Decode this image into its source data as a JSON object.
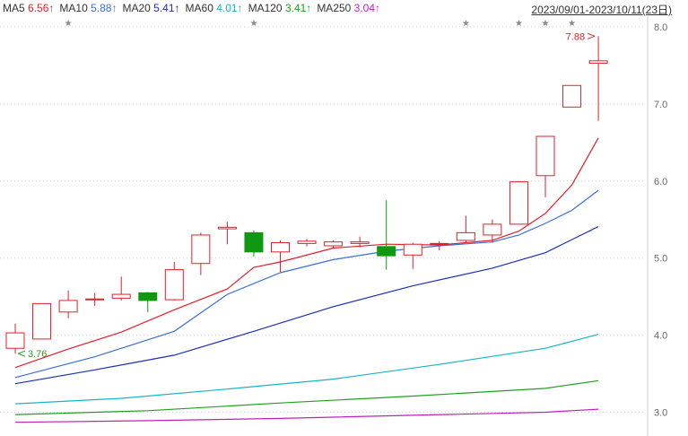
{
  "legend": [
    {
      "label": "MA5",
      "value": "6.56↑",
      "color": "#e0202a"
    },
    {
      "label": "MA10",
      "value": "5.88↑",
      "color": "#3b6fd4"
    },
    {
      "label": "MA20",
      "value": "5.41↑",
      "color": "#1a2fb8"
    },
    {
      "label": "MA60",
      "value": "4.01↑",
      "color": "#16b4c8"
    },
    {
      "label": "MA120",
      "value": "3.41↑",
      "color": "#1fa01f"
    },
    {
      "label": "MA250",
      "value": "3.04↑",
      "color": "#c020c0"
    }
  ],
  "date_range": "2023/09/01-2023/10/11(23日)",
  "colors": {
    "up": "#e0202a",
    "down": "#109810",
    "grid": "#cfcfcf",
    "axis_text": "#666666",
    "star": "#8a8a8a"
  },
  "chart_data": {
    "type": "candlestick",
    "y_ticks": [
      "8.0",
      "7.0",
      "6.0",
      "5.0",
      "4.0",
      "3.0"
    ],
    "ylim": [
      2.85,
      8.05
    ],
    "candles": [
      {
        "o": 3.83,
        "c": 4.03,
        "h": 4.15,
        "l": 3.76
      },
      {
        "o": 3.95,
        "c": 4.41,
        "h": 4.41,
        "l": 3.95
      },
      {
        "o": 4.3,
        "c": 4.45,
        "h": 4.58,
        "l": 4.22
      },
      {
        "o": 4.47,
        "c": 4.47,
        "h": 4.55,
        "l": 4.38
      },
      {
        "o": 4.48,
        "c": 4.53,
        "h": 4.76,
        "l": 4.45
      },
      {
        "o": 4.55,
        "c": 4.45,
        "h": 4.56,
        "l": 4.3
      },
      {
        "o": 4.46,
        "c": 4.85,
        "h": 4.95,
        "l": 4.45
      },
      {
        "o": 4.93,
        "c": 5.3,
        "h": 5.33,
        "l": 4.78
      },
      {
        "o": 5.38,
        "c": 5.4,
        "h": 5.47,
        "l": 5.18
      },
      {
        "o": 5.33,
        "c": 5.08,
        "h": 5.36,
        "l": 5.02
      },
      {
        "o": 5.08,
        "c": 5.2,
        "h": 5.23,
        "l": 4.82
      },
      {
        "o": 5.19,
        "c": 5.22,
        "h": 5.25,
        "l": 5.15
      },
      {
        "o": 5.16,
        "c": 5.21,
        "h": 5.23,
        "l": 5.12
      },
      {
        "o": 5.19,
        "c": 5.21,
        "h": 5.28,
        "l": 5.14
      },
      {
        "o": 5.15,
        "c": 5.03,
        "h": 5.75,
        "l": 4.85
      },
      {
        "o": 5.04,
        "c": 5.18,
        "h": 5.2,
        "l": 4.86
      },
      {
        "o": 5.18,
        "c": 5.19,
        "h": 5.22,
        "l": 5.1
      },
      {
        "o": 5.23,
        "c": 5.33,
        "h": 5.55,
        "l": 5.2
      },
      {
        "o": 5.3,
        "c": 5.44,
        "h": 5.5,
        "l": 5.2
      },
      {
        "o": 5.44,
        "c": 5.99,
        "h": 6.0,
        "l": 5.44
      },
      {
        "o": 6.07,
        "c": 6.58,
        "h": 6.58,
        "l": 5.79
      },
      {
        "o": 6.96,
        "c": 7.24,
        "h": 7.24,
        "l": 6.96
      },
      {
        "o": 7.53,
        "c": 7.56,
        "h": 7.88,
        "l": 6.78
      }
    ],
    "moving_averages": [
      {
        "name": "MA5",
        "color": "#e0202a",
        "points": [
          [
            0,
            3.58
          ],
          [
            2,
            3.82
          ],
          [
            4,
            4.04
          ],
          [
            6,
            4.33
          ],
          [
            8,
            4.6
          ],
          [
            9,
            4.88
          ],
          [
            10,
            4.95
          ],
          [
            12,
            5.13
          ],
          [
            14,
            5.18
          ],
          [
            16,
            5.17
          ],
          [
            18,
            5.23
          ],
          [
            19,
            5.35
          ],
          [
            20,
            5.58
          ],
          [
            21,
            5.95
          ],
          [
            22,
            6.56
          ]
        ]
      },
      {
        "name": "MA10",
        "color": "#3b6fd4",
        "points": [
          [
            0,
            3.45
          ],
          [
            3,
            3.72
          ],
          [
            6,
            4.05
          ],
          [
            8,
            4.53
          ],
          [
            10,
            4.81
          ],
          [
            12,
            4.98
          ],
          [
            14,
            5.09
          ],
          [
            16,
            5.16
          ],
          [
            18,
            5.21
          ],
          [
            19,
            5.3
          ],
          [
            20,
            5.45
          ],
          [
            21,
            5.62
          ],
          [
            22,
            5.88
          ]
        ]
      },
      {
        "name": "MA20",
        "color": "#1a2fb8",
        "points": [
          [
            0,
            3.37
          ],
          [
            3,
            3.55
          ],
          [
            6,
            3.74
          ],
          [
            9,
            4.05
          ],
          [
            12,
            4.37
          ],
          [
            15,
            4.64
          ],
          [
            18,
            4.87
          ],
          [
            20,
            5.07
          ],
          [
            22,
            5.41
          ]
        ]
      },
      {
        "name": "MA60",
        "color": "#16b4c8",
        "points": [
          [
            0,
            3.11
          ],
          [
            4,
            3.18
          ],
          [
            8,
            3.3
          ],
          [
            12,
            3.43
          ],
          [
            16,
            3.62
          ],
          [
            20,
            3.83
          ],
          [
            22,
            4.01
          ]
        ]
      },
      {
        "name": "MA120",
        "color": "#1fa01f",
        "points": [
          [
            0,
            2.97
          ],
          [
            5,
            3.02
          ],
          [
            10,
            3.12
          ],
          [
            15,
            3.21
          ],
          [
            20,
            3.31
          ],
          [
            22,
            3.41
          ]
        ]
      },
      {
        "name": "MA250",
        "color": "#c020c0",
        "points": [
          [
            0,
            2.87
          ],
          [
            5,
            2.89
          ],
          [
            10,
            2.92
          ],
          [
            15,
            2.96
          ],
          [
            20,
            3.0
          ],
          [
            22,
            3.04
          ]
        ]
      }
    ],
    "annotations": [
      {
        "text": "3.76",
        "index": 0,
        "price": 3.76,
        "color": "#1fa01f",
        "side": "right"
      },
      {
        "text": "7.88",
        "index": 22,
        "price": 7.88,
        "color": "#e0202a",
        "side": "left"
      }
    ],
    "star_markers": [
      2,
      9,
      17,
      19,
      20,
      21
    ]
  }
}
